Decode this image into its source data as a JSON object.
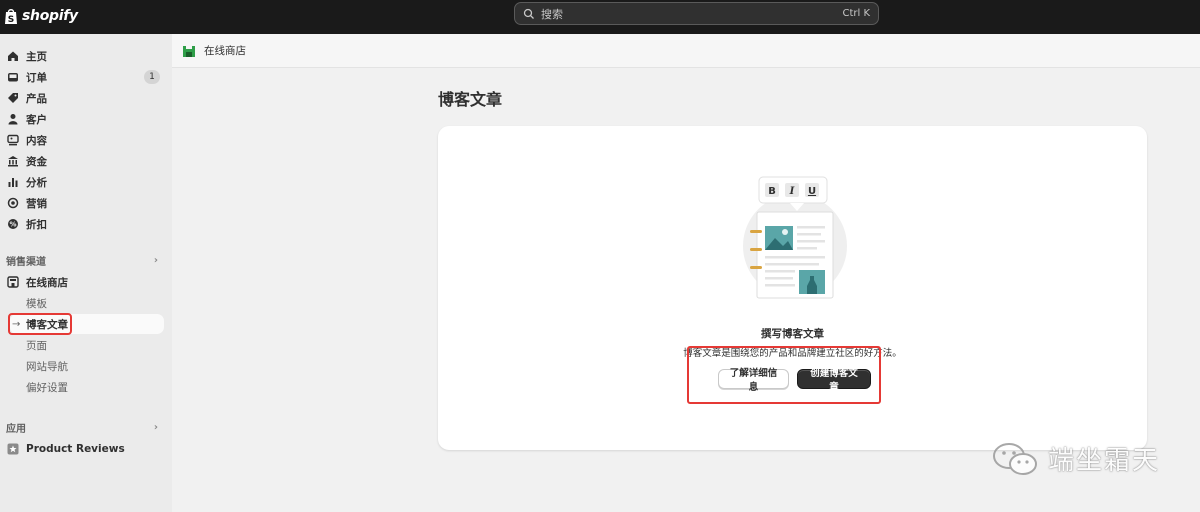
{
  "app": {
    "logo_text": "shopify"
  },
  "search": {
    "placeholder": "搜索",
    "shortcut": "Ctrl K"
  },
  "sidebar": {
    "items": [
      {
        "label": "主页",
        "icon": "home-icon"
      },
      {
        "label": "订单",
        "icon": "inbox-icon",
        "badge": "1"
      },
      {
        "label": "产品",
        "icon": "tag-icon"
      },
      {
        "label": "客户",
        "icon": "person-icon"
      },
      {
        "label": "内容",
        "icon": "content-icon"
      },
      {
        "label": "资金",
        "icon": "bank-icon"
      },
      {
        "label": "分析",
        "icon": "bar-chart-icon"
      },
      {
        "label": "营销",
        "icon": "target-icon"
      },
      {
        "label": "折扣",
        "icon": "discount-icon"
      }
    ],
    "sales_channels_label": "销售渠道",
    "online_store_label": "在线商店",
    "online_store_subitems": [
      "模板",
      "博客文章",
      "页面",
      "网站导航",
      "偏好设置"
    ],
    "active_subitem": "博客文章",
    "apps_label": "应用",
    "apps": [
      {
        "label": "Product Reviews",
        "icon": "app-icon"
      }
    ]
  },
  "breadcrumb": {
    "label": "在线商店"
  },
  "page": {
    "title": "博客文章"
  },
  "empty_state": {
    "heading": "撰写博客文章",
    "body": "博客文章是围绕您的产品和品牌建立社区的好方法。",
    "secondary_button": "了解详细信息",
    "primary_button": "创建博客文章"
  },
  "watermark": {
    "text": "端坐霜天"
  },
  "colors": {
    "topbar": "#1a1a1a",
    "highlight": "#e53935",
    "primary_button": "#303030",
    "illus_teal": "#5aa6a8"
  }
}
